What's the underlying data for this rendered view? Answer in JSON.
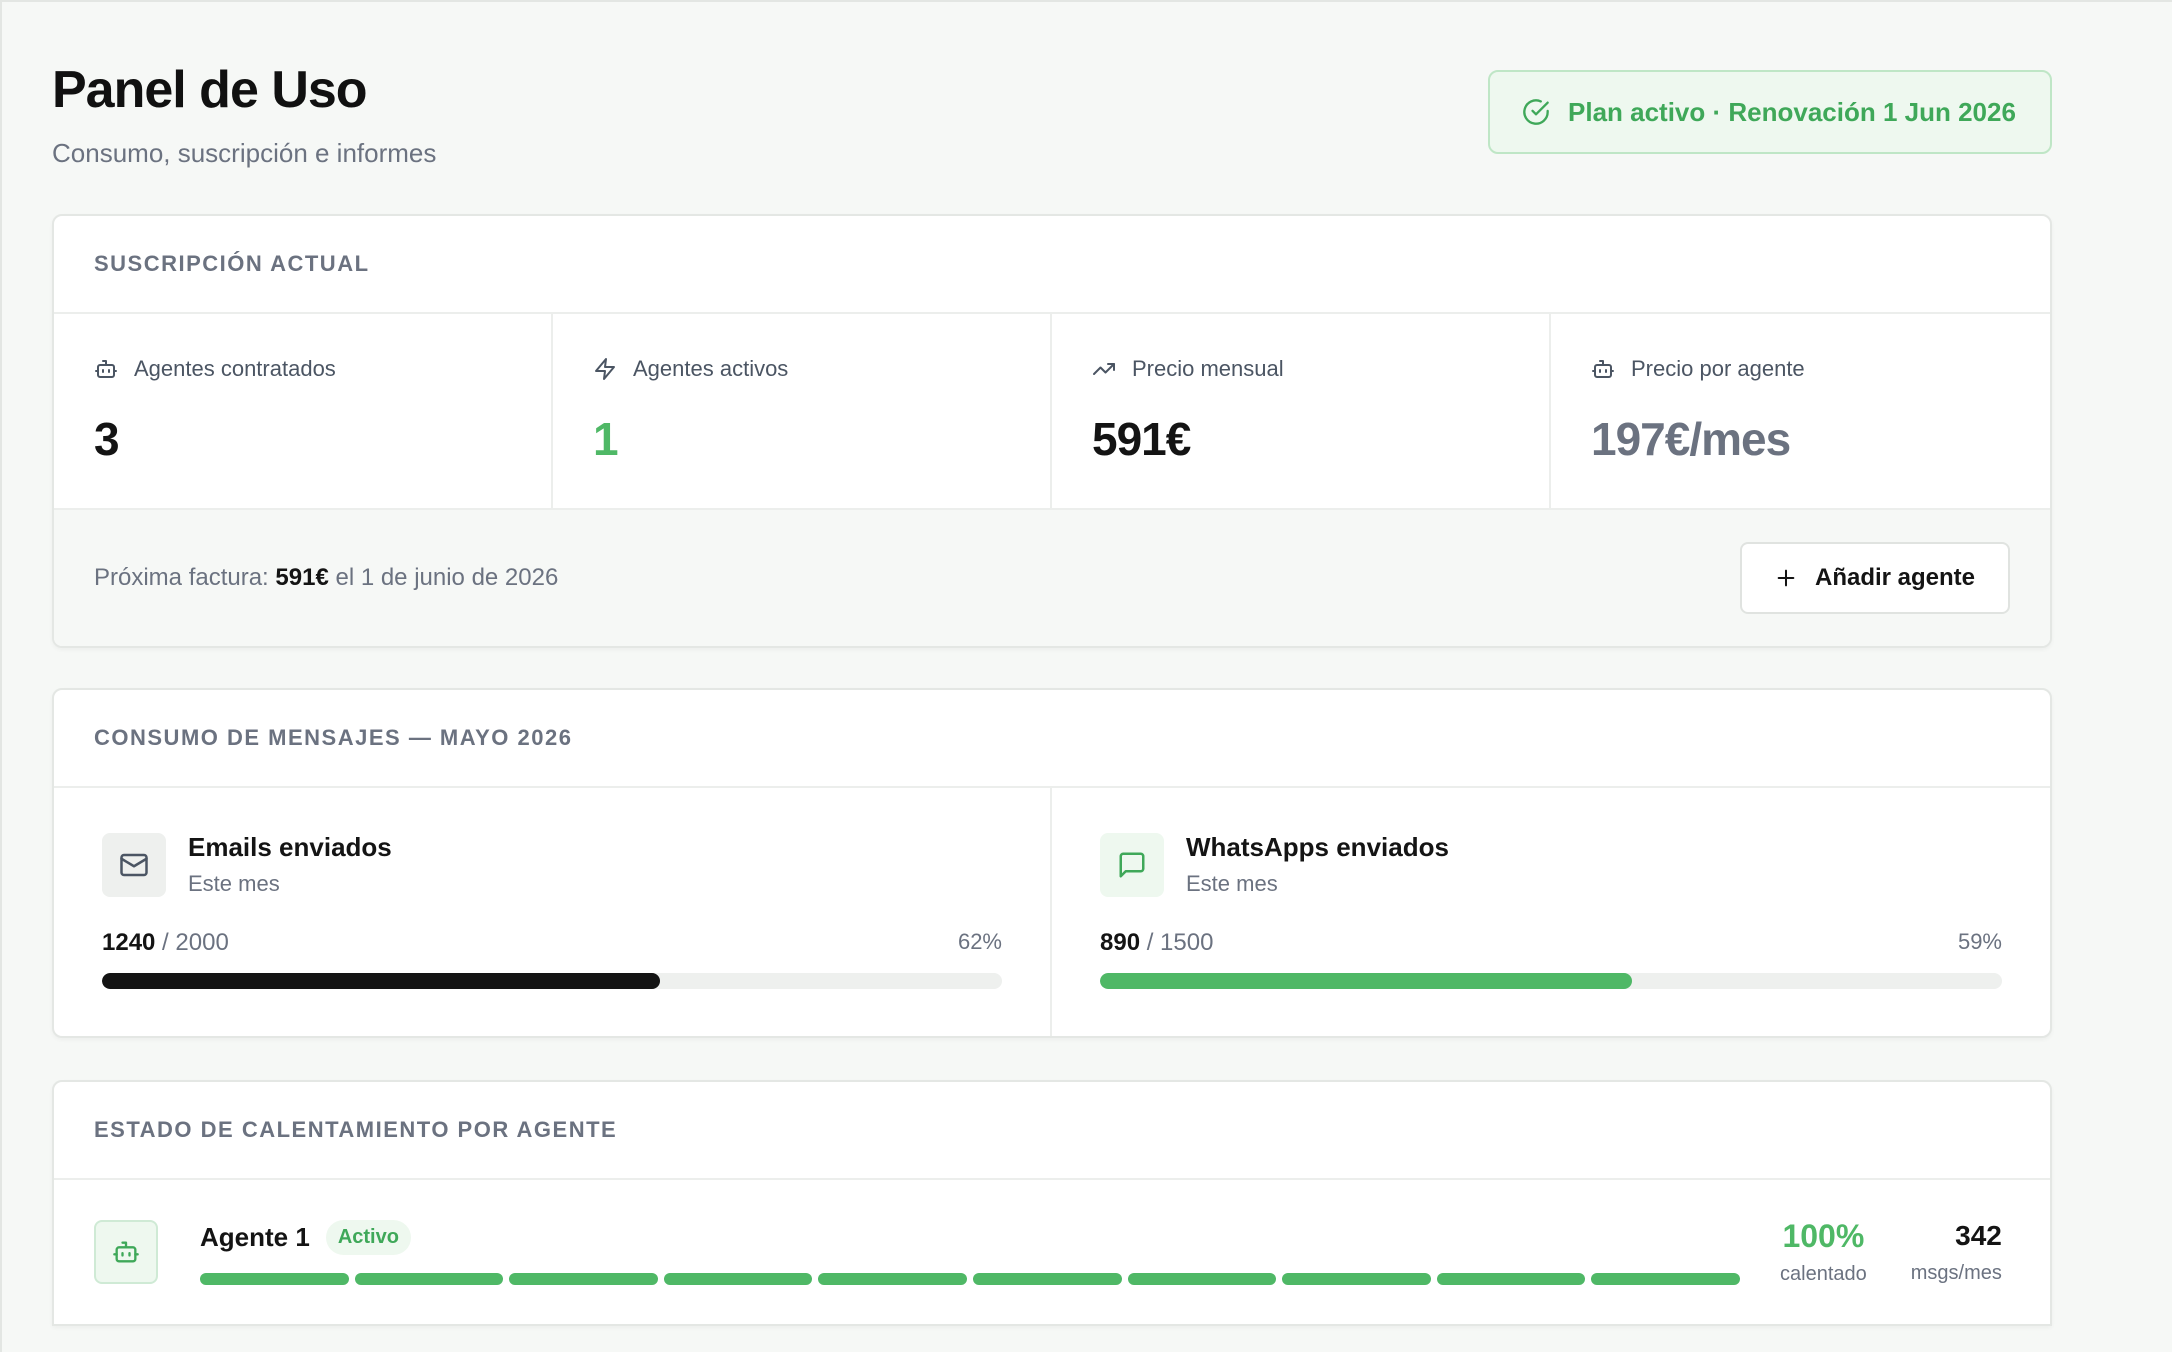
{
  "header": {
    "title": "Panel de Uso",
    "subtitle": "Consumo, suscripción e informes",
    "plan_badge": "Plan activo · Renovación 1 Jun 2026"
  },
  "subscription": {
    "heading": "Suscripción actual",
    "stats": [
      {
        "label": "Agentes contratados",
        "value": "3",
        "icon": "bot-icon"
      },
      {
        "label": "Agentes activos",
        "value": "1",
        "icon": "bolt-icon"
      },
      {
        "label": "Precio mensual",
        "value": "591€",
        "icon": "trending-up-icon"
      },
      {
        "label": "Precio por agente",
        "value": "197€/mes",
        "icon": "bot-icon"
      }
    ],
    "billing_prefix": "Próxima factura: ",
    "billing_amount": "591€",
    "billing_suffix": " el 1 de junio de 2026",
    "add_button": "Añadir agente"
  },
  "consumption": {
    "heading": "Consumo de mensajes — Mayo 2026",
    "items": [
      {
        "title": "Emails enviados",
        "sub": "Este mes",
        "used": "1240",
        "limit": " / 2000",
        "pct": "62%",
        "fraction": 0.62,
        "icon": "mail-icon",
        "color": "#141414"
      },
      {
        "title": "WhatsApps enviados",
        "sub": "Este mes",
        "used": "890",
        "limit": " / 1500",
        "pct": "59%",
        "fraction": 0.59,
        "icon": "chat-icon",
        "color": "#4fb866"
      }
    ]
  },
  "warmup": {
    "heading": "Estado de calentamiento por agente",
    "agents": [
      {
        "name": "Agente 1",
        "status": "Activo",
        "segments_done": 10,
        "pct": "100%",
        "pct_label": "calentado",
        "msgs": "342",
        "msgs_label": "msgs/mes"
      }
    ]
  },
  "colors": {
    "accent": "#4fb866",
    "badge_bg": "#eef8ef",
    "text": "#141414",
    "muted": "#6b7280"
  }
}
